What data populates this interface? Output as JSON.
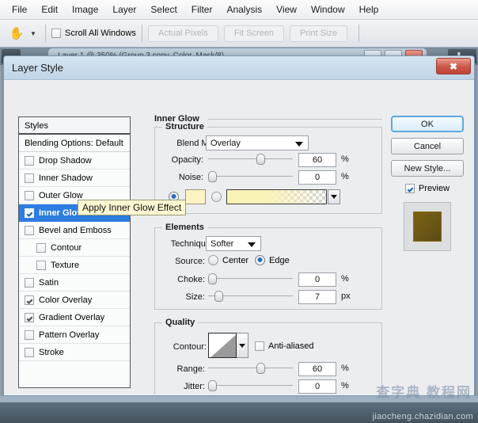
{
  "app": {
    "menus": [
      "File",
      "Edit",
      "Image",
      "Layer",
      "Select",
      "Filter",
      "Analysis",
      "View",
      "Window",
      "Help"
    ],
    "options_bar": {
      "hand_tool_icon": "hand-tool-icon",
      "tool_caret_icon": "chevron-down-icon",
      "scroll_all_windows_label": "Scroll All Windows",
      "scroll_all_windows_checked": false,
      "buttons": [
        "Actual Pixels",
        "Fit Screen",
        "Print Size"
      ]
    },
    "document_title": "Layer 1 @ 350% (Group 3 copy, Color, Mask/8)"
  },
  "dialog": {
    "title": "Layer Style",
    "close_icon": "close-icon",
    "styles_panel": {
      "header": "Styles",
      "blending_options": "Blending Options: Default",
      "items": [
        {
          "label": "Drop Shadow",
          "checked": false,
          "selected": false,
          "indent": false
        },
        {
          "label": "Inner Shadow",
          "checked": false,
          "selected": false,
          "indent": false
        },
        {
          "label": "Outer Glow",
          "checked": false,
          "selected": false,
          "indent": false
        },
        {
          "label": "Inner Glow",
          "checked": true,
          "selected": true,
          "indent": false
        },
        {
          "label": "Bevel and Emboss",
          "checked": false,
          "selected": false,
          "indent": false
        },
        {
          "label": "Contour",
          "checked": false,
          "selected": false,
          "indent": true
        },
        {
          "label": "Texture",
          "checked": false,
          "selected": false,
          "indent": true
        },
        {
          "label": "Satin",
          "checked": false,
          "selected": false,
          "indent": false
        },
        {
          "label": "Color Overlay",
          "checked": true,
          "selected": false,
          "indent": false
        },
        {
          "label": "Gradient Overlay",
          "checked": true,
          "selected": false,
          "indent": false
        },
        {
          "label": "Pattern Overlay",
          "checked": false,
          "selected": false,
          "indent": false
        },
        {
          "label": "Stroke",
          "checked": false,
          "selected": false,
          "indent": false
        }
      ]
    },
    "panel_title": "Inner Glow",
    "structure": {
      "group_label": "Structure",
      "blend_mode_label": "Blend Mode:",
      "blend_mode_value": "Overlay",
      "opacity_label": "Opacity:",
      "opacity_value": "60",
      "opacity_unit": "%",
      "noise_label": "Noise:",
      "noise_value": "0",
      "noise_unit": "%",
      "fill_type": "color",
      "color_swatch_hex": "#fbf3c4",
      "gradient_start_hex": "#faf3b7"
    },
    "elements": {
      "group_label": "Elements",
      "technique_label": "Technique:",
      "technique_value": "Softer",
      "source_label": "Source:",
      "source_center_label": "Center",
      "source_edge_label": "Edge",
      "source_value": "Edge",
      "choke_label": "Choke:",
      "choke_value": "0",
      "choke_unit": "%",
      "size_label": "Size:",
      "size_value": "7",
      "size_unit": "px"
    },
    "quality": {
      "group_label": "Quality",
      "contour_label": "Contour:",
      "contour_dropdown_icon": "chevron-down-icon",
      "anti_aliased_label": "Anti-aliased",
      "anti_aliased_checked": false,
      "range_label": "Range:",
      "range_value": "60",
      "range_unit": "%",
      "jitter_label": "Jitter:",
      "jitter_value": "0",
      "jitter_unit": "%"
    },
    "actions": {
      "ok_label": "OK",
      "cancel_label": "Cancel",
      "new_style_label": "New Style...",
      "preview_label": "Preview",
      "preview_checked": true
    }
  },
  "tooltip": {
    "text": "Apply Inner Glow Effect"
  },
  "watermark": {
    "cn": "查字典  教程网",
    "url": "jiaocheng.chazidian.com"
  },
  "colors": {
    "accent_blue": "#2d7de0",
    "dialog_bg": "#ebedef",
    "title_bar": "#c0d5e8",
    "close_red": "#cc5647"
  }
}
